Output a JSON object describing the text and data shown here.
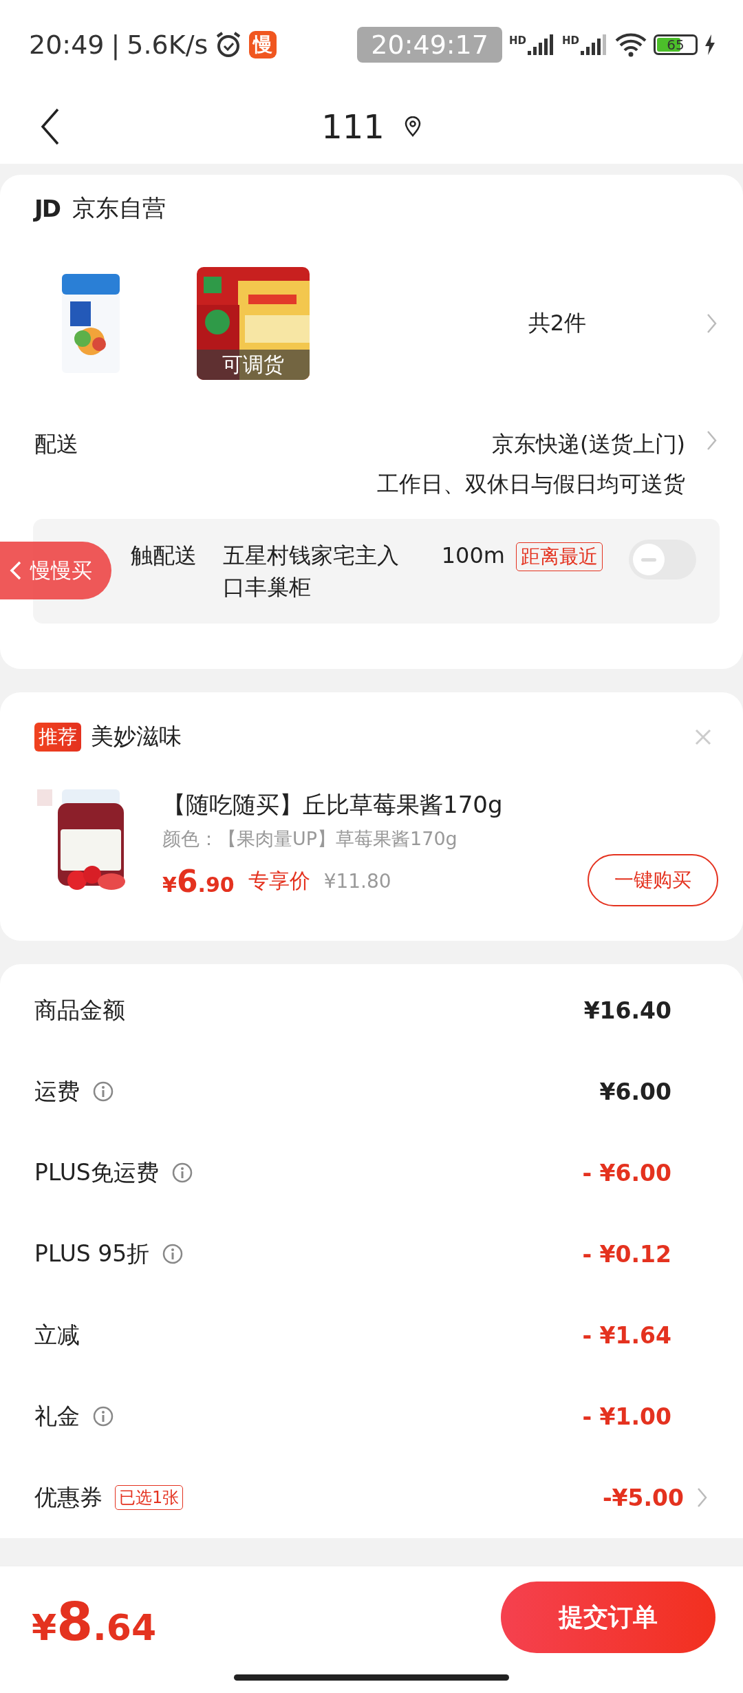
{
  "status_bar": {
    "time": "20:49",
    "separator": "|",
    "speed": "5.6K/s",
    "app_badge": "慢",
    "clock": "20:49:17",
    "signal_labels": [
      "HD",
      "HD"
    ],
    "battery": "65"
  },
  "header": {
    "title": "111"
  },
  "shop": {
    "logo": "JD",
    "name": "京东自营",
    "images": [
      {
        "kind": "picture"
      },
      {
        "kind": "picture",
        "overlay": "可调货"
      }
    ],
    "count": "共2件",
    "delivery": {
      "label": "配送",
      "method": "京东快递(送货上门)",
      "note": "工作日、双休日与假日均可送货"
    },
    "contactless": {
      "label": "触配送",
      "locker": "五星村钱家宅主入口丰巢柜",
      "distance": "100m",
      "tag": "距离最近",
      "on": false
    }
  },
  "floating_button": {
    "label": "慢慢买"
  },
  "recommend": {
    "tag": "推荐",
    "title": "美妙滋味",
    "product": {
      "name": "【随吃随买】丘比草莓果酱170g",
      "spec": "颜色：【果肉量UP】草莓果酱170g",
      "price_currency": "¥",
      "price_integer": "6",
      "price_decimal": ".90",
      "price_label": "专享价",
      "original_price": "¥11.80",
      "button": "一键购买"
    }
  },
  "summary": [
    {
      "label": "商品金额",
      "info": false,
      "kind": "charge",
      "amount": "¥16.40",
      "chevron": false
    },
    {
      "label": "运费",
      "info": true,
      "kind": "charge",
      "amount": "¥6.00",
      "chevron": false
    },
    {
      "label": "PLUS免运费",
      "info": true,
      "kind": "discount",
      "amount": "- ¥6.00",
      "chevron": false
    },
    {
      "label": "PLUS 95折",
      "info": true,
      "kind": "discount",
      "amount": "- ¥0.12",
      "chevron": false
    },
    {
      "label": "立减",
      "info": false,
      "kind": "discount",
      "amount": "- ¥1.64",
      "chevron": false
    },
    {
      "label": "礼金",
      "info": true,
      "kind": "discount",
      "amount": "- ¥1.00",
      "chevron": false
    },
    {
      "label": "优惠券",
      "info": false,
      "badge": "已选1张",
      "kind": "discount",
      "amount": "-¥5.00",
      "chevron": true
    }
  ],
  "footer": {
    "currency": "¥",
    "integer": "8",
    "decimal": ".64",
    "submit": "提交订单"
  }
}
